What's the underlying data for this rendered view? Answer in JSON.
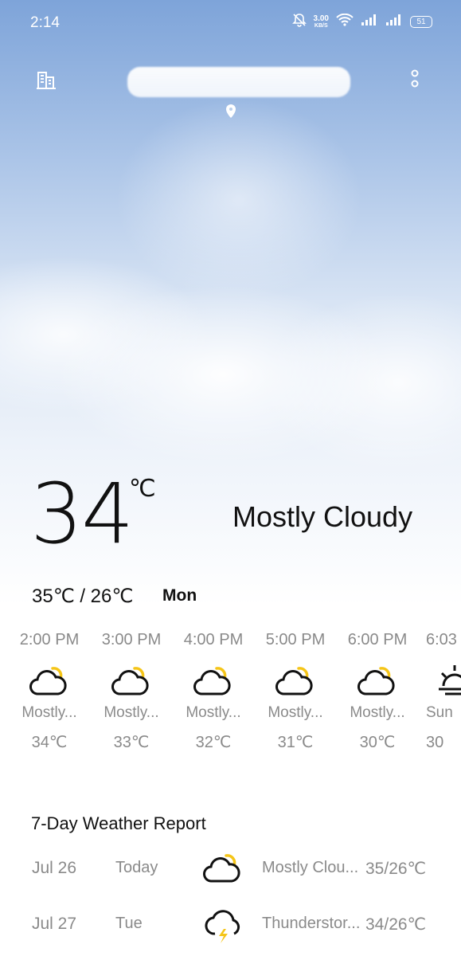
{
  "status_bar": {
    "time": "2:14",
    "net_speed_value": "3.00",
    "net_speed_unit": "KB/S",
    "battery": "51"
  },
  "header": {
    "location_name": "",
    "icons": [
      "city-list-icon",
      "more-options-icon",
      "location-pin-icon"
    ]
  },
  "current": {
    "temperature": "34",
    "unit": "℃",
    "condition": "Mostly Cloudy",
    "hi_lo": "35℃ / 26℃",
    "day": "Mon"
  },
  "hourly": [
    {
      "time": "2:00 PM",
      "condition": "Mostly...",
      "temp": "34℃",
      "icon": "partly-cloudy-icon"
    },
    {
      "time": "3:00 PM",
      "condition": "Mostly...",
      "temp": "33℃",
      "icon": "partly-cloudy-icon"
    },
    {
      "time": "4:00 PM",
      "condition": "Mostly...",
      "temp": "32℃",
      "icon": "partly-cloudy-icon"
    },
    {
      "time": "5:00 PM",
      "condition": "Mostly...",
      "temp": "31℃",
      "icon": "partly-cloudy-icon"
    },
    {
      "time": "6:00 PM",
      "condition": "Mostly...",
      "temp": "30℃",
      "icon": "partly-cloudy-icon"
    },
    {
      "time": "6:03",
      "condition": "Sun",
      "temp": "30",
      "icon": "sunset-icon"
    }
  ],
  "weekly": {
    "title": "7-Day Weather Report",
    "days": [
      {
        "date": "Jul 26",
        "day": "Today",
        "condition": "Mostly Clou...",
        "temp": "35/26℃",
        "icon": "partly-cloudy-icon"
      },
      {
        "date": "Jul 27",
        "day": "Tue",
        "condition": "Thunderstor...",
        "temp": "34/26℃",
        "icon": "thunderstorm-icon"
      }
    ]
  },
  "colors": {
    "sun_accent": "#f5c518",
    "text_primary": "#111111",
    "text_secondary": "#8a8a8a"
  }
}
